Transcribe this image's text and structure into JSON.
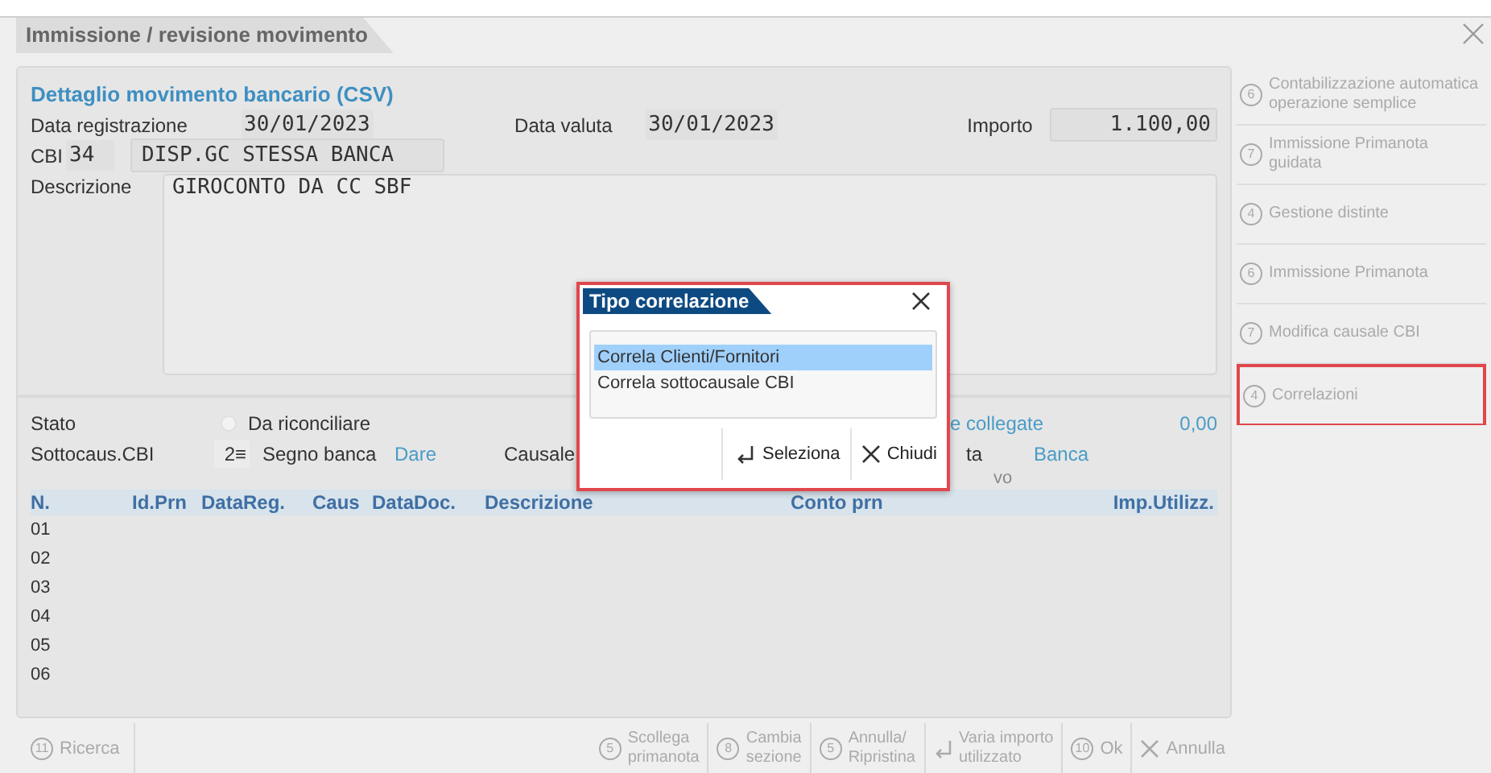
{
  "window": {
    "title": "Immissione / revisione movimento"
  },
  "detail": {
    "title": "Dettaglio movimento bancario (CSV)",
    "data_registrazione": {
      "label": "Data registrazione",
      "value": "30/01/2023"
    },
    "data_valuta": {
      "label": "Data valuta",
      "value": "30/01/2023"
    },
    "importo": {
      "label": "Importo",
      "value": "1.100,00"
    },
    "cbi": {
      "label": "CBI",
      "code": "34",
      "description": "DISP.GC STESSA BANCA"
    },
    "descrizione": {
      "label": "Descrizione",
      "value": "GIROCONTO DA CC SBF"
    }
  },
  "status": {
    "stato": {
      "label": "Stato",
      "option": "Da riconciliare",
      "checked": false
    },
    "sottocausale": {
      "label": "Sottocaus.CBI",
      "value": "2",
      "glyph": "≡"
    },
    "segno_banca": {
      "label": "Segno banca",
      "value": "Dare"
    },
    "causale": {
      "label": "Causale"
    },
    "collegate": {
      "label": "e collegate",
      "value": "0,00"
    },
    "row_2_partial": {
      "label": "ta",
      "value": "Banca"
    },
    "row_3_partial": {
      "label": "vo"
    }
  },
  "table": {
    "columns": [
      "N.",
      "Id.Prn",
      "DataReg.",
      "Caus",
      "DataDoc.",
      "Descrizione",
      "Conto prn",
      "Imp.Utilizz."
    ],
    "rows": [
      "01",
      "02",
      "03",
      "04",
      "05",
      "06"
    ]
  },
  "sidebar": [
    {
      "key": "6",
      "lines": [
        "Contabilizzazione automatica",
        "operazione semplice"
      ],
      "disabled": true,
      "highlighted": false
    },
    {
      "key": "7",
      "lines": [
        "Immissione Primanota",
        "guidata"
      ],
      "disabled": true,
      "highlighted": false
    },
    {
      "key": "4",
      "lines": [
        "Gestione distinte"
      ],
      "disabled": true,
      "highlighted": false
    },
    {
      "key": "6",
      "lines": [
        "Immissione Primanota"
      ],
      "disabled": true,
      "highlighted": false
    },
    {
      "key": "7",
      "lines": [
        "Modifica causale CBI"
      ],
      "disabled": true,
      "highlighted": false
    },
    {
      "key": "4",
      "lines": [
        "Correlazioni"
      ],
      "disabled": true,
      "highlighted": true
    }
  ],
  "toolbar": {
    "left": [
      {
        "kind": "numbered",
        "key": "11",
        "lines": [
          "Ricerca"
        ],
        "disabled": true
      }
    ],
    "right": [
      {
        "kind": "numbered",
        "key": "5",
        "lines": [
          "Scollega",
          "primanota"
        ],
        "disabled": true
      },
      {
        "kind": "numbered",
        "key": "8",
        "lines": [
          "Cambia",
          "sezione"
        ],
        "disabled": true
      },
      {
        "kind": "numbered",
        "key": "5",
        "lines": [
          "Annulla/",
          "Ripristina"
        ],
        "disabled": true
      },
      {
        "kind": "enter",
        "lines": [
          "Varia importo",
          "utilizzato"
        ],
        "disabled": true
      },
      {
        "kind": "numbered",
        "key": "10",
        "lines": [
          "Ok"
        ],
        "disabled": true
      },
      {
        "kind": "close",
        "lines": [
          "Annulla"
        ],
        "disabled": true
      }
    ]
  },
  "dialog": {
    "title": "Tipo correlazione",
    "highlighted": true,
    "items": [
      {
        "label": "Correla Clienti/Fornitori",
        "selected": true
      },
      {
        "label": "Correla sottocausale CBI",
        "selected": false
      }
    ],
    "buttons": [
      {
        "kind": "enter",
        "label": "Seleziona"
      },
      {
        "kind": "close",
        "label": "Chiudi"
      }
    ]
  }
}
